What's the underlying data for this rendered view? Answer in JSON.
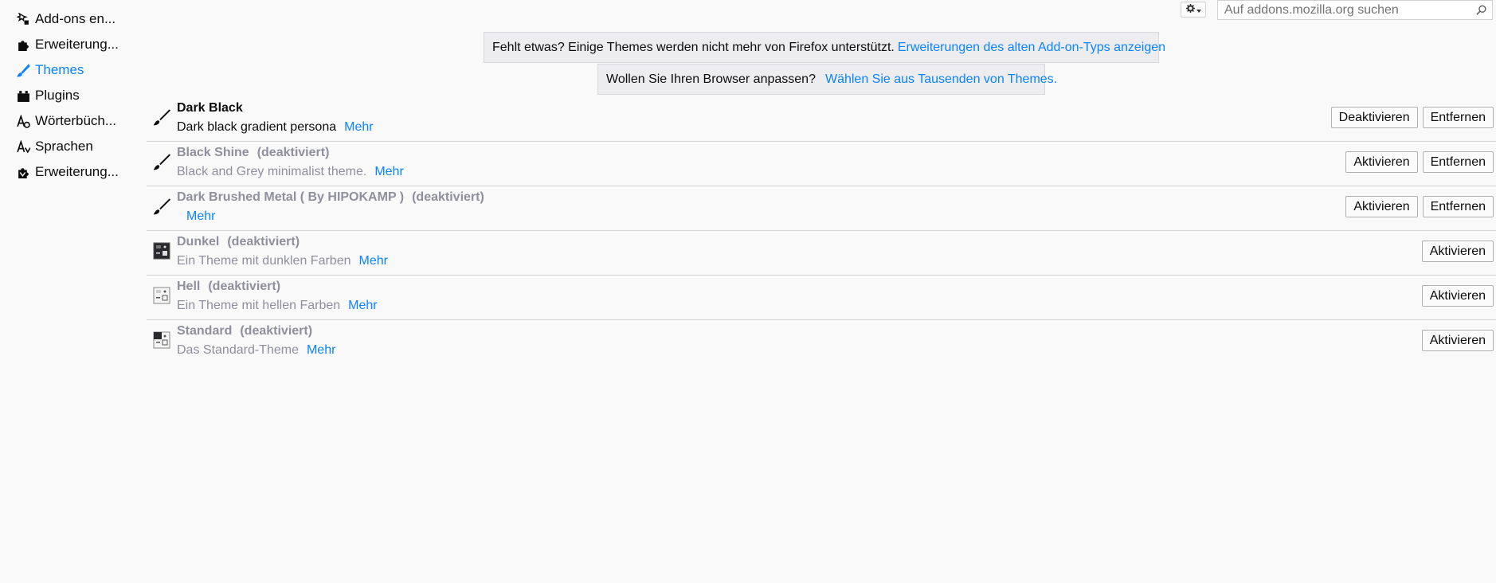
{
  "sidebar": {
    "items": [
      {
        "label": "Add-ons en...",
        "icon": "get-addons-icon",
        "active": false
      },
      {
        "label": "Erweiterung...",
        "icon": "puzzle-icon",
        "active": false
      },
      {
        "label": "Themes",
        "icon": "paintbrush-icon",
        "active": true
      },
      {
        "label": "Plugins",
        "icon": "plugin-icon",
        "active": false
      },
      {
        "label": "Wörterbüch...",
        "icon": "dictionary-icon",
        "active": false
      },
      {
        "label": "Sprachen",
        "icon": "language-icon",
        "active": false
      },
      {
        "label": "Erweiterung...",
        "icon": "legacy-puzzle-icon",
        "active": false
      }
    ]
  },
  "toolbar": {
    "gear_icon": "gear-icon",
    "search_placeholder": "Auf addons.mozilla.org suchen"
  },
  "notices": {
    "legacy_text": "Fehlt etwas? Einige Themes werden nicht mehr von Firefox unterstützt.",
    "legacy_link": "Erweiterungen des alten Add-on-Typs anzeigen",
    "customize_text": "Wollen Sie Ihren Browser anpassen?",
    "customize_link": "Wählen Sie aus Tausenden von Themes."
  },
  "themes": [
    {
      "name": "Dark Black",
      "state": "",
      "description": "Dark black gradient persona",
      "more": "Mehr",
      "primary_button": "Deaktivieren",
      "remove_button": "Entfernen"
    },
    {
      "name": "Black Shine",
      "state": "(deaktiviert)",
      "description": "Black and Grey minimalist theme.",
      "more": "Mehr",
      "primary_button": "Aktivieren",
      "remove_button": "Entfernen"
    },
    {
      "name": "Dark Brushed Metal ( By HIPOKAMP )",
      "state": "(deaktiviert)",
      "description": "",
      "more": "Mehr",
      "primary_button": "Aktivieren",
      "remove_button": "Entfernen"
    },
    {
      "name": "Dunkel",
      "state": "(deaktiviert)",
      "description": "Ein Theme mit dunklen Farben",
      "more": "Mehr",
      "primary_button": "Aktivieren"
    },
    {
      "name": "Hell",
      "state": "(deaktiviert)",
      "description": "Ein Theme mit hellen Farben",
      "more": "Mehr",
      "primary_button": "Aktivieren"
    },
    {
      "name": "Standard",
      "state": "(deaktiviert)",
      "description": "Das Standard-Theme",
      "more": "Mehr",
      "primary_button": "Aktivieren"
    }
  ],
  "colors": {
    "accent": "#0a84ff",
    "disabled_text": "#8f8f9d",
    "background": "#f9f9fa"
  }
}
